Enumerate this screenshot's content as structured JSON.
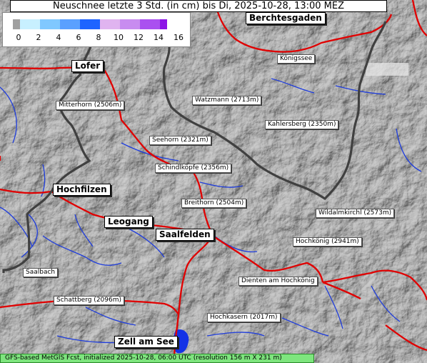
{
  "title": "Neuschnee letzte 3 Std. (in cm) bis Di, 2025-10-28, 13:00 MEZ",
  "legend": {
    "ticks": [
      "0",
      "2",
      "4",
      "6",
      "8",
      "10",
      "12",
      "14",
      "16"
    ],
    "colors": [
      "#a0a0a0",
      "#c8f0ff",
      "#80c8ff",
      "#5aa0ff",
      "#1e64ff",
      "#e0b4f0",
      "#c88cf0",
      "#aa50f0",
      "#8c14e6"
    ]
  },
  "places": [
    {
      "name": "Berchtesgaden",
      "type": "town"
    },
    {
      "name": "Königssee",
      "type": "peak"
    },
    {
      "name": "Lofer",
      "type": "town"
    },
    {
      "name": "Watzmann (2713m)",
      "type": "peak"
    },
    {
      "name": "Mitterhorn (2506m)",
      "type": "peak"
    },
    {
      "name": "Kahlersberg (2350m)",
      "type": "peak"
    },
    {
      "name": "Seehorn (2321m)",
      "type": "peak"
    },
    {
      "name": "Schindlköpfe (2356m)",
      "type": "peak"
    },
    {
      "name": "Hochfilzen",
      "type": "town"
    },
    {
      "name": "Breithorn (2504m)",
      "type": "peak"
    },
    {
      "name": "Wildalmkirchl (2573m)",
      "type": "peak"
    },
    {
      "name": "Leogang",
      "type": "town"
    },
    {
      "name": "Saalfelden",
      "type": "town"
    },
    {
      "name": "Hochkönig (2941m)",
      "type": "peak"
    },
    {
      "name": "Saalbach",
      "type": "peak"
    },
    {
      "name": "Dienten am Hochkönig",
      "type": "peak"
    },
    {
      "name": "Schattberg (2096m)",
      "type": "peak"
    },
    {
      "name": "Hochkasern (2017m)",
      "type": "peak"
    },
    {
      "name": "Zell am See",
      "type": "town"
    }
  ],
  "footer": "GFS-based MetGIS Fcst, initialized 2025-10-28, 06:00 UTC  (resolution 156 m X 231 m)",
  "colors": {
    "border": "#404040",
    "roads": "#e00000",
    "rivers": "#1e3cdc",
    "lake": "#1432e6",
    "terrain": "#8c8c8c"
  }
}
